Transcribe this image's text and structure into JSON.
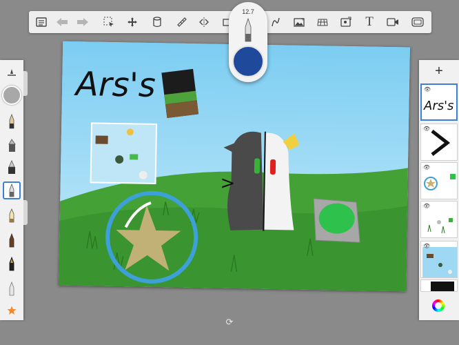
{
  "toolbar": {
    "icons": [
      "layers-list-icon",
      "undo-icon",
      "redo-icon",
      "selection-icon",
      "transform-icon",
      "fill-bucket-icon",
      "ruler-icon",
      "symmetry-icon",
      "crop-icon",
      "curve-icon",
      "image-icon",
      "perspective-icon",
      "import-image-icon",
      "text-icon",
      "video-icon",
      "fullscreen-icon"
    ],
    "text_tool_label": "T"
  },
  "brush_popover": {
    "size": "12.7",
    "color": "#1f4a9b"
  },
  "artwork": {
    "title_text": "Ars's",
    "arrow_text": ">",
    "sky_color": "#8fd4f4",
    "grass_color": "#3f9b33"
  },
  "layers": {
    "add_label": "+",
    "count": 6
  },
  "brush_panel": {
    "brushes": [
      "pencil",
      "airbrush",
      "marker",
      "pen",
      "ballpoint",
      "chisel",
      "paintbrush",
      "watercolor",
      "eraser"
    ]
  }
}
